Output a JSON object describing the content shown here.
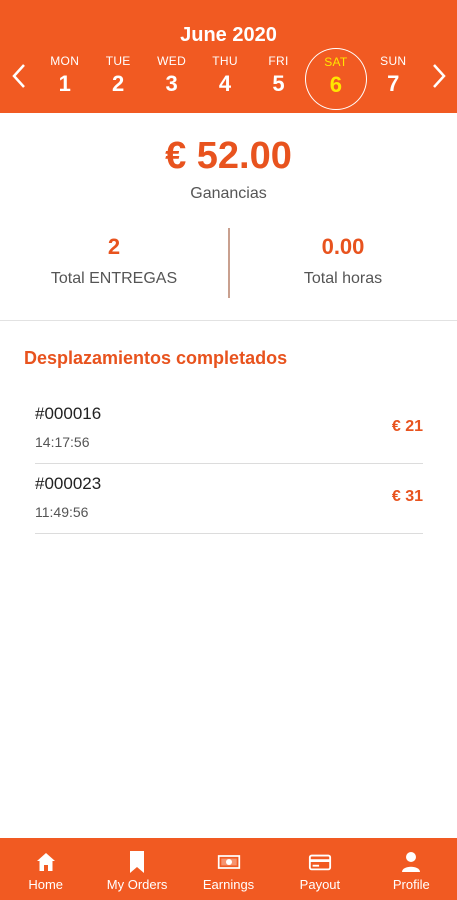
{
  "header": {
    "month": "June 2020",
    "prev_icon": "chevron-left-icon",
    "next_icon": "chevron-right-icon",
    "days": [
      {
        "name": "MON",
        "num": "1"
      },
      {
        "name": "TUE",
        "num": "2"
      },
      {
        "name": "WED",
        "num": "3"
      },
      {
        "name": "THU",
        "num": "4"
      },
      {
        "name": "FRI",
        "num": "5"
      },
      {
        "name": "SAT",
        "num": "6",
        "selected": true
      },
      {
        "name": "SUN",
        "num": "7"
      }
    ]
  },
  "summary": {
    "amount": "€ 52.00",
    "amount_label": "Ganancias",
    "deliveries_value": "2",
    "deliveries_label": "Total ENTREGAS",
    "hours_value": "0.00",
    "hours_label": "Total horas"
  },
  "section_title": "Desplazamientos completados",
  "trips": [
    {
      "id": "#000016",
      "time": "14:17:56",
      "price": "€ 21"
    },
    {
      "id": "#000023",
      "time": "11:49:56",
      "price": "€ 31"
    }
  ],
  "nav": [
    {
      "label": "Home",
      "icon": "home-icon"
    },
    {
      "label": "My Orders",
      "icon": "bookmark-icon"
    },
    {
      "label": "Earnings",
      "icon": "banknote-icon"
    },
    {
      "label": "Payout",
      "icon": "credit-card-icon"
    },
    {
      "label": "Profile",
      "icon": "person-icon"
    }
  ],
  "colors": {
    "accent": "#f15a22",
    "text_accent": "#e8531e",
    "selected_day": "#ffe600"
  }
}
